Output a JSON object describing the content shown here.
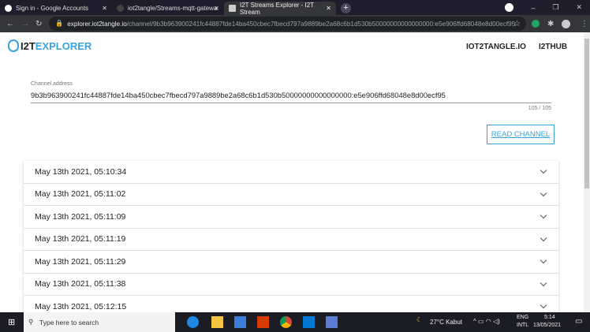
{
  "browser": {
    "tabs": [
      {
        "title": "Sign in - Google Accounts"
      },
      {
        "title": "iot2tangle/Streams-mqtt-gatewa"
      },
      {
        "title": "I2T Streams Explorer - I2T Stream"
      }
    ],
    "url_domain": "explorer.iot2tangle.io",
    "url_path": "/channel/9b3b963900241fc44887fde14ba450cbec7fbecd797a9889be2a68c6b1d530b50000000000000000:e5e906ffd68048e8d00ecf95"
  },
  "header": {
    "logo_a": "I2T",
    "logo_b": "EXPLORER",
    "nav": [
      "IOT2TANGLE.IO",
      "I2THUB"
    ]
  },
  "form": {
    "label": "Channel address",
    "value": "9b3b963900241fc44887fde14ba450cbec7fbecd797a9889be2a68c6b1d530b50000000000000000:e5e906ffd68048e8d00ecf95",
    "counter": "105 / 105",
    "button": "READ CHANNEL"
  },
  "messages": [
    "May 13th 2021, 05:10:34",
    "May 13th 2021, 05:11:02",
    "May 13th 2021, 05:11:09",
    "May 13th 2021, 05:11:19",
    "May 13th 2021, 05:11:29",
    "May 13th 2021, 05:11:38",
    "May 13th 2021, 05:12:15"
  ],
  "taskbar": {
    "search_placeholder": "Type here to search",
    "weather": "27°C  Kabut",
    "lang1": "ENG",
    "lang2": "INTL",
    "time": "5:14",
    "date": "13/05/2021"
  }
}
